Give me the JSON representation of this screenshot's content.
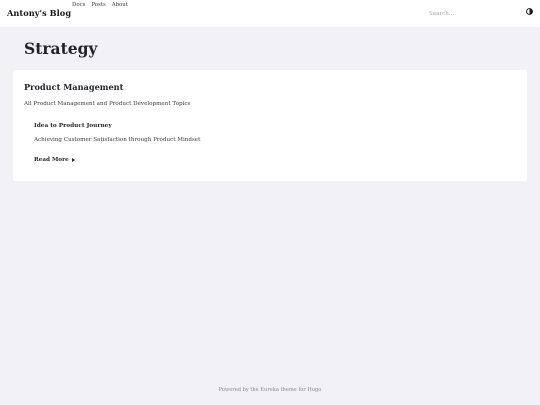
{
  "header": {
    "brand": "Antony's Blog",
    "nav": [
      {
        "label": "Docs"
      },
      {
        "label": "Posts"
      },
      {
        "label": "About"
      }
    ],
    "search_placeholder": "Search...",
    "theme_toggle_icon": "half-moon-contrast-icon"
  },
  "page": {
    "title": "Strategy"
  },
  "section": {
    "title": "Product Management",
    "description": "All Product Management and Product Development Topics",
    "posts": [
      {
        "title": "Idea to Product Journey",
        "summary": "Achieving Customer Satisfaction through Product Mindset",
        "read_more": "Read More"
      }
    ]
  },
  "footer": {
    "text": "Powered by the Eureka theme for Hugo"
  }
}
